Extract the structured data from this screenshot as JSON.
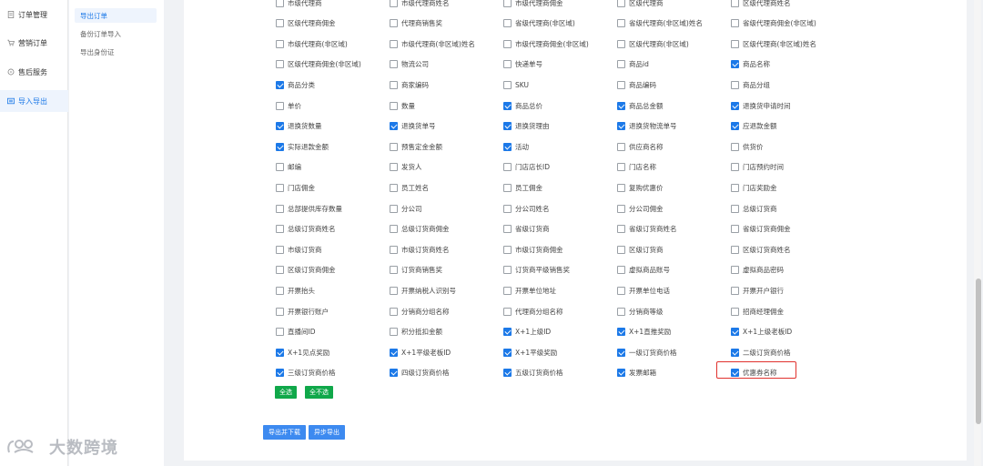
{
  "sidebar": {
    "items": [
      {
        "label": "订单管理",
        "icon": "file-icon",
        "active": false
      },
      {
        "label": "营销订单",
        "icon": "cart-icon",
        "active": false
      },
      {
        "label": "售后服务",
        "icon": "service-icon",
        "active": false
      },
      {
        "label": "导入导出",
        "icon": "import-export-icon",
        "active": true
      }
    ]
  },
  "sub_sidebar": {
    "items": [
      {
        "label": "导出订单",
        "active": true
      },
      {
        "label": "备份订单导入",
        "active": false
      },
      {
        "label": "导出身份证",
        "active": false
      }
    ]
  },
  "fields": [
    [
      "市级代理商",
      false
    ],
    [
      "市级代理商姓名",
      false
    ],
    [
      "市级代理商佣金",
      false
    ],
    [
      "区级代理商",
      false
    ],
    [
      "区级代理商姓名",
      false
    ],
    [
      "区级代理商佣金",
      false
    ],
    [
      "代理商销售奖",
      false
    ],
    [
      "省级代理商(非区域)",
      false
    ],
    [
      "省级代理商(非区域)姓名",
      false
    ],
    [
      "省级代理商佣金(非区域)",
      false
    ],
    [
      "市级代理商(非区域)",
      false
    ],
    [
      "市级代理商(非区域)姓名",
      false
    ],
    [
      "市级代理商佣金(非区域)",
      false
    ],
    [
      "区级代理商(非区域)",
      false
    ],
    [
      "区级代理商(非区域)姓名",
      false
    ],
    [
      "区级代理商佣金(非区域)",
      false
    ],
    [
      "物流公司",
      false
    ],
    [
      "快递单号",
      false
    ],
    [
      "商品id",
      false
    ],
    [
      "商品名称",
      true
    ],
    [
      "商品分类",
      true
    ],
    [
      "商家编码",
      false
    ],
    [
      "SKU",
      false
    ],
    [
      "商品编码",
      false
    ],
    [
      "商品分组",
      false
    ],
    [
      "单价",
      false
    ],
    [
      "数量",
      false
    ],
    [
      "商品总价",
      true
    ],
    [
      "商品总金额",
      true
    ],
    [
      "退换货申请时间",
      true
    ],
    [
      "退换货数量",
      true
    ],
    [
      "退换货单号",
      true
    ],
    [
      "退换货理由",
      true
    ],
    [
      "退换货物流单号",
      true
    ],
    [
      "应退款金额",
      true
    ],
    [
      "实际退款金额",
      true
    ],
    [
      "预售定金金额",
      false
    ],
    [
      "活动",
      true
    ],
    [
      "供应商名称",
      false
    ],
    [
      "供货价",
      false
    ],
    [
      "邮编",
      false
    ],
    [
      "发货人",
      false
    ],
    [
      "门店店长ID",
      false
    ],
    [
      "门店名称",
      false
    ],
    [
      "门店预约时间",
      false
    ],
    [
      "门店佣金",
      false
    ],
    [
      "员工姓名",
      false
    ],
    [
      "员工佣金",
      false
    ],
    [
      "复购优惠价",
      false
    ],
    [
      "门店奖励金",
      false
    ],
    [
      "总部提供库存数量",
      false
    ],
    [
      "分公司",
      false
    ],
    [
      "分公司姓名",
      false
    ],
    [
      "分公司佣金",
      false
    ],
    [
      "总级订货商",
      false
    ],
    [
      "总级订货商姓名",
      false
    ],
    [
      "总级订货商佣金",
      false
    ],
    [
      "省级订货商",
      false
    ],
    [
      "省级订货商姓名",
      false
    ],
    [
      "省级订货商佣金",
      false
    ],
    [
      "市级订货商",
      false
    ],
    [
      "市级订货商姓名",
      false
    ],
    [
      "市级订货商佣金",
      false
    ],
    [
      "区级订货商",
      false
    ],
    [
      "区级订货商姓名",
      false
    ],
    [
      "区级订货商佣金",
      false
    ],
    [
      "订货商销售奖",
      false
    ],
    [
      "订货商平级销售奖",
      false
    ],
    [
      "虚拟商品账号",
      false
    ],
    [
      "虚拟商品密码",
      false
    ],
    [
      "开票抬头",
      false
    ],
    [
      "开票纳税人识别号",
      false
    ],
    [
      "开票单位地址",
      false
    ],
    [
      "开票单位电话",
      false
    ],
    [
      "开票开户银行",
      false
    ],
    [
      "开票银行账户",
      false
    ],
    [
      "分销商分组名称",
      false
    ],
    [
      "代理商分组名称",
      false
    ],
    [
      "分销商等级",
      false
    ],
    [
      "招商经理佣金",
      false
    ],
    [
      "直播间ID",
      false
    ],
    [
      "积分抵扣金额",
      false
    ],
    [
      "X+1上级ID",
      true
    ],
    [
      "X+1直推奖励",
      true
    ],
    [
      "X+1上级老板ID",
      true
    ],
    [
      "X+1见点奖励",
      true
    ],
    [
      "X+1平级老板ID",
      true
    ],
    [
      "X+1平级奖励",
      true
    ],
    [
      "一级订货商价格",
      true
    ],
    [
      "二级订货商价格",
      true
    ],
    [
      "三级订货商价格",
      true
    ],
    [
      "四级订货商价格",
      true
    ],
    [
      "五级订货商价格",
      true
    ],
    [
      "发票邮箱",
      true
    ],
    [
      "优惠券名称",
      true
    ]
  ],
  "select_buttons": {
    "select_all": "全选",
    "select_none": "全不选"
  },
  "export_buttons": {
    "export_download": "导出并下载",
    "async_export": "异步导出"
  },
  "watermark": {
    "text": "大数跨境"
  },
  "colors": {
    "accent": "#1c79e8",
    "green": "#10a84a",
    "highlight": "#e0312d"
  }
}
